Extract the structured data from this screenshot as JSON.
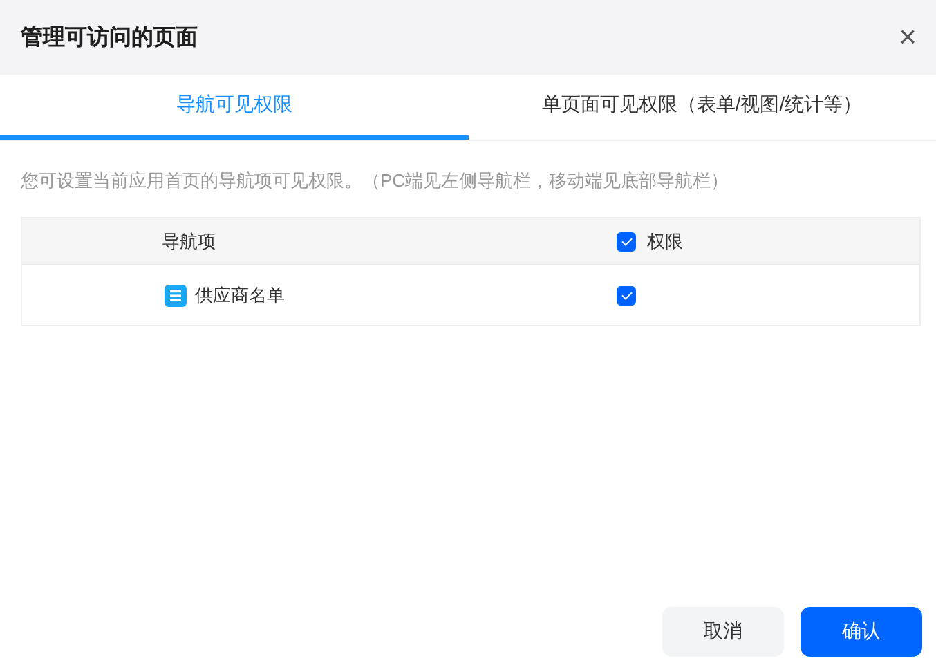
{
  "window": {
    "title": "管理可访问的页面",
    "close": "×"
  },
  "tabs": [
    {
      "label": "导航可见权限",
      "selected": true
    },
    {
      "label": "单页面可见权限（表单/视图/统计等）",
      "selected": false
    }
  ],
  "description": "您可设置当前应用首页的导航项可见权限。（PC端见左侧导航栏，移动端见底部导航栏）",
  "table": {
    "columns": [
      {
        "label": "导航项"
      },
      {
        "label": "权限",
        "checked": true
      }
    ],
    "rows": [
      {
        "name": "供应商名单",
        "checked": true
      }
    ]
  },
  "buttons": [
    {
      "label": "取消",
      "kind": "secondary"
    },
    {
      "label": "确认",
      "kind": "primary"
    }
  ]
}
